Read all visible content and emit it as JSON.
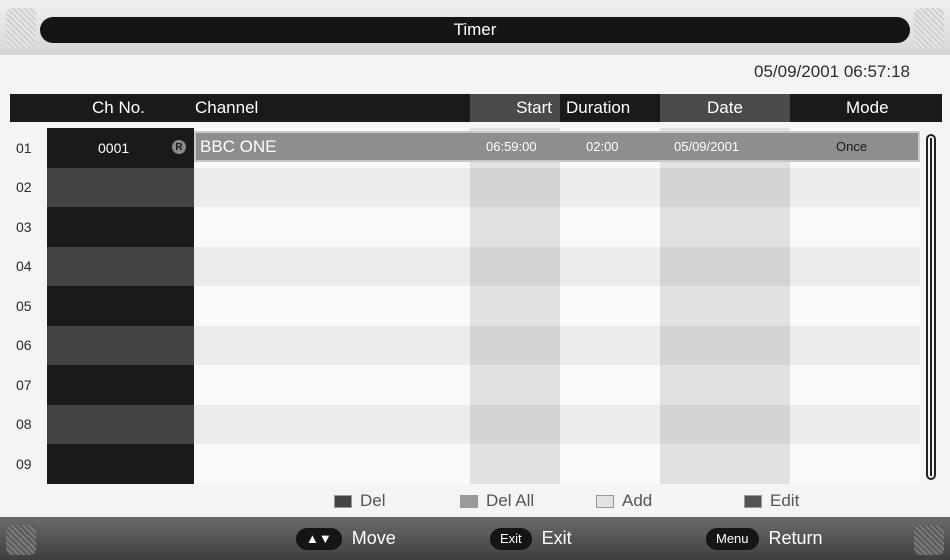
{
  "title": "Timer",
  "datetime": "05/09/2001 06:57:18",
  "columns": {
    "ch_no": "Ch No.",
    "channel": "Channel",
    "start": "Start",
    "duration": "Duration",
    "date": "Date",
    "mode": "Mode"
  },
  "row_numbers": [
    "01",
    "02",
    "03",
    "04",
    "05",
    "06",
    "07",
    "08",
    "09"
  ],
  "entry": {
    "ch_no": "0001",
    "rec_badge": "R",
    "channel": "BBC ONE",
    "start": "06:59:00",
    "duration": "02:00",
    "date": "05/09/2001",
    "mode": "Once"
  },
  "legend": {
    "del": "Del",
    "del_all": "Del All",
    "add": "Add",
    "edit": "Edit"
  },
  "footer": {
    "move_key": "▲▼",
    "move": "Move",
    "exit_key": "Exit",
    "exit": "Exit",
    "menu_key": "Menu",
    "return": "Return"
  },
  "colors": {
    "del": "#444444",
    "del_all": "#9a9a9a",
    "add": "#e2e2e2",
    "edit": "#555555"
  }
}
